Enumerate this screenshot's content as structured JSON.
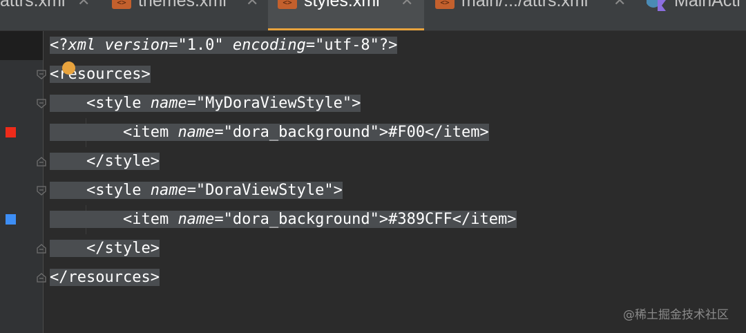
{
  "tabs": [
    {
      "label": "attrs.xml",
      "close": "✕",
      "icon": "xml-file-icon"
    },
    {
      "label": "themes.xml",
      "close": "✕",
      "icon": "xml-file-icon"
    },
    {
      "label": "styles.xml",
      "close": "✕",
      "icon": "xml-file-icon",
      "active": true
    },
    {
      "label": "main/.../attrs.xml",
      "close": "✕",
      "icon": "xml-file-icon"
    },
    {
      "label": "MainActi",
      "icon": "kotlin-class-icon"
    }
  ],
  "xml_icon_glyph": "<>",
  "colors": {
    "accent": "#e8a33d",
    "tag": "#ffffff",
    "swatch_red": "#ee2b1a",
    "swatch_blue": "#3d8ef5",
    "selection": "#4a4d50"
  },
  "code": {
    "line1": {
      "a": "<?",
      "b": "xml ",
      "c": "version",
      "d": "=\"1.0\" ",
      "e": "encoding",
      "f": "=\"utf-8\"?>"
    },
    "line2": "<resources>",
    "line3": {
      "a": "    <style ",
      "b": "name",
      "c": "=\"MyDoraViewStyle\">"
    },
    "line4": {
      "a": "        <item ",
      "b": "name",
      "c": "=\"dora_background\">#F00</item>"
    },
    "line5": "    </style>",
    "line6": {
      "a": "    <style ",
      "b": "name",
      "c": "=\"DoraViewStyle\">"
    },
    "line7": {
      "a": "        <item ",
      "b": "name",
      "c": "=\"dora_background\">#389CFF</item>"
    },
    "line8": "    </style>",
    "line9": "</resources>"
  },
  "watermark": "@稀土掘金技术社区"
}
